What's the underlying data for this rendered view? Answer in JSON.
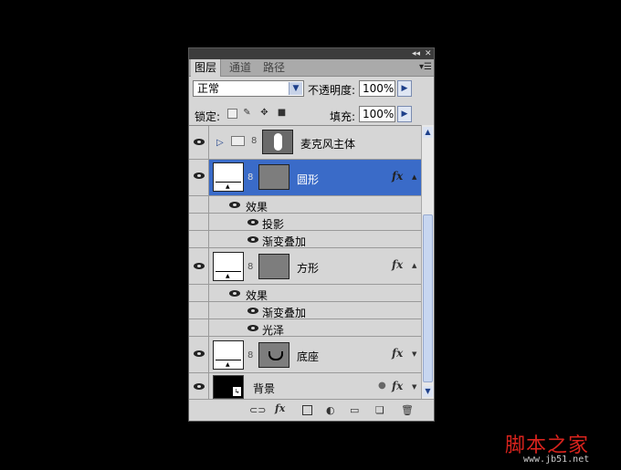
{
  "panel": {
    "tabs": [
      "图层",
      "通道",
      "路径"
    ],
    "blend_mode": "正常",
    "opacity_label": "不透明度:",
    "opacity_value": "100%",
    "lock_label": "锁定:",
    "fill_label": "填充:",
    "fill_value": "100%"
  },
  "layers": [
    {
      "name": "麦克风主体",
      "kind": "group"
    },
    {
      "name": "圆形",
      "kind": "layer",
      "selected": true,
      "fx": "fx",
      "effects_label": "效果",
      "effects": [
        "投影",
        "渐变叠加"
      ]
    },
    {
      "name": "方形",
      "kind": "layer",
      "fx": "fx",
      "effects_label": "效果",
      "effects": [
        "渐变叠加",
        "光泽"
      ]
    },
    {
      "name": "底座",
      "kind": "layer",
      "fx": "fx"
    },
    {
      "name": "背景",
      "kind": "background",
      "fx": "fx"
    }
  ],
  "bottom_icons": [
    "link-icon",
    "fx-icon",
    "mask-icon",
    "adjustment-icon",
    "group-folder-icon",
    "new-layer-icon",
    "trash-icon"
  ],
  "watermark": {
    "text": "脚本之家",
    "url": "www.jb51.net"
  },
  "colors": {
    "selected_row": "#3a6bc8",
    "background": "#000000",
    "panel": "#d6d6d6",
    "watermark": "#d8231d"
  }
}
